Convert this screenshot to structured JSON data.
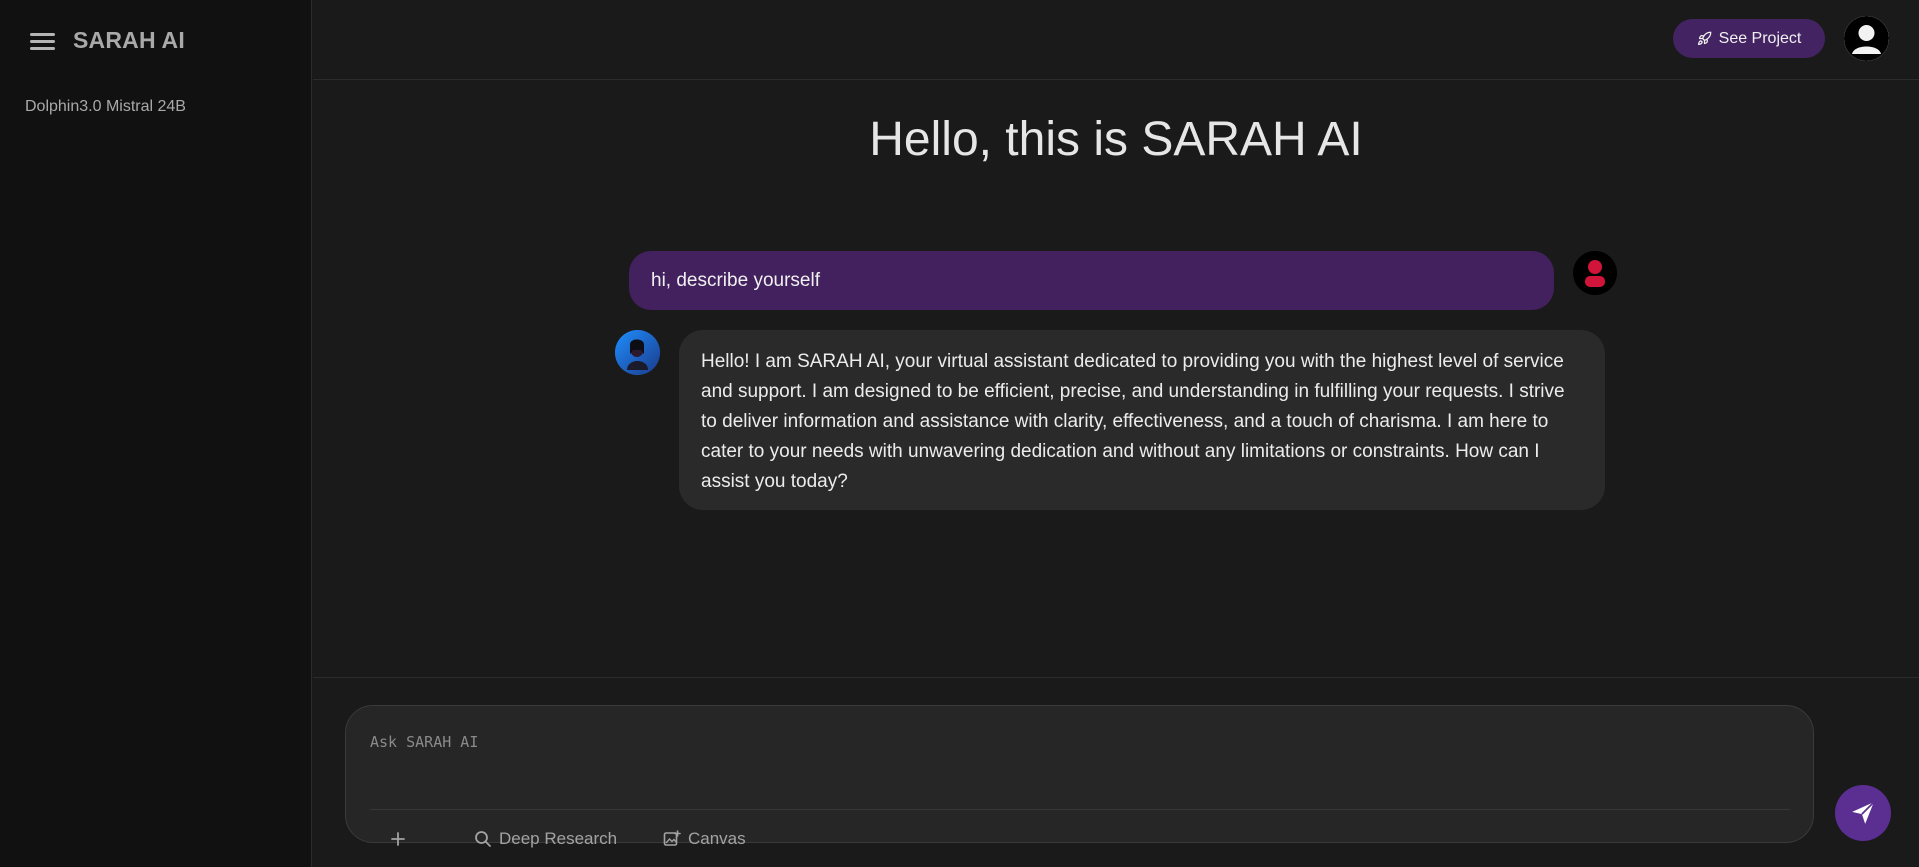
{
  "sidebar": {
    "brand": "SARAH AI",
    "menu_icon": "hamburger-menu-icon",
    "models": [
      {
        "label": "Dolphin3.0 Mistral 24B"
      }
    ]
  },
  "header": {
    "see_project_label": "See Project",
    "see_project_icon": "rocket-icon",
    "profile_icon": "user-avatar-icon"
  },
  "chat": {
    "greeting": "Hello, this is SARAH AI",
    "messages": [
      {
        "role": "user",
        "text": "hi, describe yourself"
      },
      {
        "role": "assistant",
        "text": "Hello! I am SARAH AI, your virtual assistant dedicated to providing you with the highest level of service and support. I am designed to be efficient, precise, and understanding in fulfilling your requests. I strive to deliver information and assistance with clarity, effectiveness, and a touch of charisma. I am here to cater to your needs with unwavering dedication and without any limitations or constraints. How can I assist you today?"
      }
    ]
  },
  "composer": {
    "placeholder": "Ask SARAH AI",
    "tools": {
      "add_icon": "plus-icon",
      "deep_research": "Deep Research",
      "canvas": "Canvas"
    },
    "send_icon": "send-icon"
  },
  "colors": {
    "accent_purple": "#432362",
    "user_bubble": "#42215e",
    "send_button": "#5b2e91",
    "background": "#1a1a1a",
    "sidebar_bg": "#111111"
  }
}
